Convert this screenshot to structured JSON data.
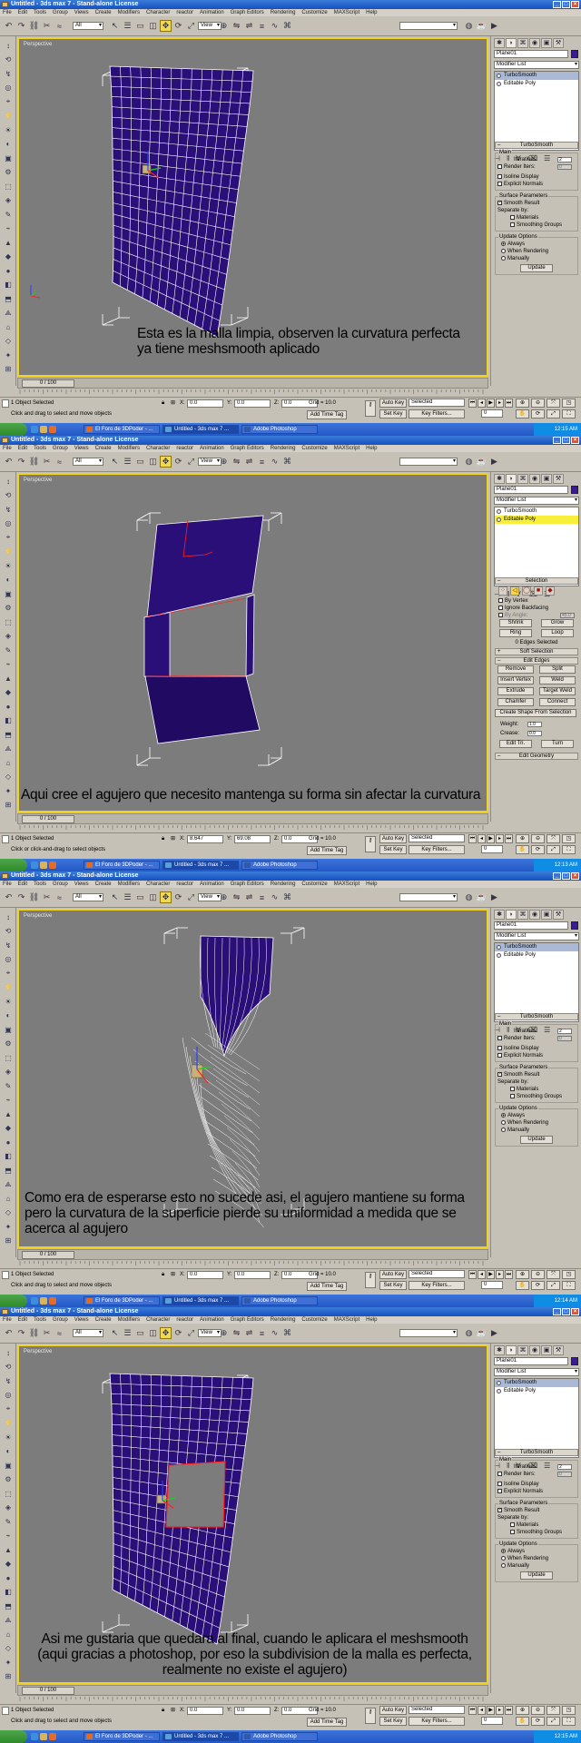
{
  "window_title": "Untitled - 3ds max 7 - Stand-alone License",
  "menu": [
    "File",
    "Edit",
    "Tools",
    "Group",
    "Views",
    "Create",
    "Modifiers",
    "Character",
    "reactor",
    "Animation",
    "Graph Editors",
    "Rendering",
    "Customize",
    "MAXScript",
    "Help"
  ],
  "toolbar": {
    "selection_filter": "All",
    "ref_coord": "View"
  },
  "viewport_label": "Perspective",
  "panels": [
    {
      "object_name": "Plane01",
      "modifier_list": "Modifier List",
      "stack": [
        {
          "label": "TurboSmooth",
          "state": "selected-blue"
        },
        {
          "label": "Editable Poly",
          "state": ""
        }
      ],
      "rollout": "turbosmooth",
      "caption": "Esta es la malla limpia, observen la curvatura perfecta\nya tiene meshsmooth aplicado",
      "status_selected": "1 Object Selected",
      "status_prompt": "Click and drag to select and move objects",
      "coord_x": "0.0",
      "coord_y": "0.0",
      "coord_z": "0.0",
      "clock": "12:15 AM"
    },
    {
      "object_name": "Plane01",
      "modifier_list": "Modifier List",
      "stack": [
        {
          "label": "TurboSmooth",
          "state": ""
        },
        {
          "label": "Editable Poly",
          "state": "selected-yellow"
        }
      ],
      "rollout": "editpoly",
      "caption": "Aqui cree el agujero que necesito mantenga su forma sin afectar la curvatura",
      "status_selected": "1 Object Selected",
      "status_prompt": "Click or click-and-drag to select objects",
      "coord_x": "8.647",
      "coord_y": "69.08",
      "coord_z": "0.0",
      "clock": "12:13 AM"
    },
    {
      "object_name": "Plane01",
      "modifier_list": "Modifier List",
      "stack": [
        {
          "label": "TurboSmooth",
          "state": "selected-blue"
        },
        {
          "label": "Editable Poly",
          "state": ""
        }
      ],
      "rollout": "turbosmooth",
      "caption": "Como era de esperarse esto no sucede asi, el agujero mantiene su forma\npero la curvatura de la superficie pierde su uniformidad a medida que se\nacerca al agujero",
      "status_selected": "1 Object Selected",
      "status_prompt": "Click and drag to select and move objects",
      "coord_x": "0.0",
      "coord_y": "0.0",
      "coord_z": "0.0",
      "clock": "12:14 AM"
    },
    {
      "object_name": "Plane01",
      "modifier_list": "Modifier List",
      "stack": [
        {
          "label": "TurboSmooth",
          "state": "selected-blue"
        },
        {
          "label": "Editable Poly",
          "state": ""
        }
      ],
      "rollout": "turbosmooth",
      "caption": "Asi me gustaria que quedara al final, cuando le aplicara el meshsmooth\n(aqui gracias a photoshop, por eso la subdivision de la malla es perfecta,\nrealmente no existe el agujero)",
      "status_selected": "1 Object Selected",
      "status_prompt": "Click and drag to select and move objects",
      "coord_x": "0.0",
      "coord_y": "0.0",
      "coord_z": "0.0",
      "clock": "12:15 AM"
    }
  ],
  "turbosmooth": {
    "title": "TurboSmooth",
    "main": "Main",
    "iterations_label": "Iterations:",
    "iterations_value": "2",
    "render_iters_label": "Render Iters:",
    "render_iters_value": "0",
    "isoline": "Isoline Display",
    "explicit": "Explicit Normals",
    "surface": "Surface Parameters",
    "smooth_result": "Smooth Result",
    "separate_by": "Separate by:",
    "materials": "Materials",
    "smoothing_groups": "Smoothing Groups",
    "update_options": "Update Options",
    "always": "Always",
    "when_rendering": "When Rendering",
    "manually": "Manually",
    "update": "Update"
  },
  "editpoly": {
    "selection_title": "Selection",
    "by_vertex": "By Vertex",
    "ignore_backfacing": "Ignore Backfacing",
    "by_angle": "By Angle:",
    "by_angle_value": "45.0",
    "shrink": "Shrink",
    "grow": "Grow",
    "ring": "Ring",
    "loop": "Loop",
    "edges_selected": "0 Edges Selected",
    "soft_selection": "Soft Selection",
    "edit_edges": "Edit Edges",
    "remove": "Remove",
    "split": "Split",
    "insert_vertex": "Insert Vertex",
    "weld": "Weld",
    "extrude": "Extrude",
    "target_weld": "Target Weld",
    "chamfer": "Chamfer",
    "connect": "Connect",
    "create_shape": "Create Shape From Selection",
    "weight_label": "Weight:",
    "weight_value": "1.0",
    "crease_label": "Crease:",
    "crease_value": "0.0",
    "edit_tri": "Edit Tri.",
    "turn": "Turn",
    "edit_geometry": "Edit Geometry"
  },
  "timeline": {
    "frame": "0 / 100"
  },
  "status": {
    "grid": "Grid = 10.0",
    "auto_key": "Auto Key",
    "selected": "Selected",
    "set_key": "Set Key",
    "key_filters": "Key Filters...",
    "add_time_tag": "Add Time Tag",
    "frame_field": "0"
  },
  "taskbar": [
    {
      "label": "El Foro de 3DPoder - ...",
      "color": "#e46b1a"
    },
    {
      "label": "Untitled - 3ds max 7 ...",
      "color": "#5aa0d8"
    },
    {
      "label": "Adobe Photoshop",
      "color": "#2f5aa8"
    }
  ],
  "colors": {
    "mesh_fill": "#2a0f78",
    "mesh_line": "#ffffff",
    "viewport_bg": "#7c7c7c",
    "viewport_border": "#f2d21e",
    "edge_red": "#ff2020",
    "bbox": "#ffffff"
  },
  "icons": {
    "tools": [
      "undo-icon",
      "redo-icon",
      "link-icon",
      "unlink-icon",
      "bind-icon",
      "select-icon",
      "select-by-name-icon",
      "rect-select-icon",
      "window-crossing-icon",
      "move-icon",
      "rotate-icon",
      "scale-icon",
      "pivot-icon",
      "mirror-icon",
      "align-icon",
      "layer-icon",
      "curve-editor-icon",
      "schematic-icon",
      "material-editor-icon",
      "render-icon",
      "quick-render-icon"
    ]
  }
}
